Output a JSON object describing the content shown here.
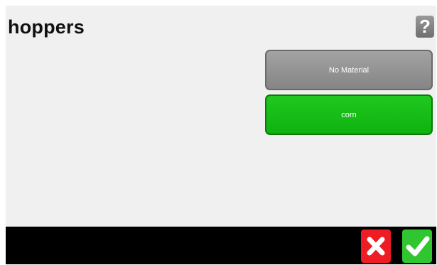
{
  "header": {
    "title": "hoppers",
    "help_icon": "question-mark-icon",
    "help_glyph": "?"
  },
  "materials": [
    {
      "label": "No Material",
      "color": "#8e8e8e"
    },
    {
      "label": "corn",
      "color": "#16bd16"
    }
  ],
  "footer": {
    "cancel_icon": "close-icon",
    "confirm_icon": "checkmark-icon",
    "cancel_color": "#ee1c25",
    "confirm_color": "#2fc62f"
  }
}
